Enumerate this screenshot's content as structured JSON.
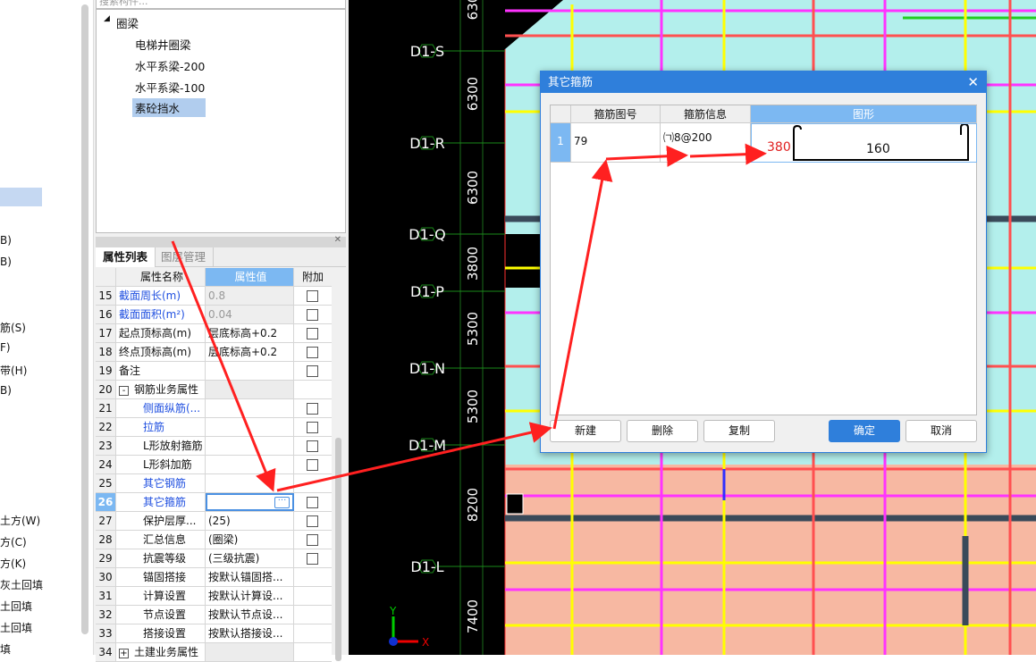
{
  "left_strip": {
    "items": [
      "B)",
      "B)",
      "筋(S)",
      "F)",
      "带(H)",
      "B)",
      "土方(W)",
      "方(C)",
      "方(K)",
      "灰土回填",
      "土回填",
      "土回填",
      "填"
    ]
  },
  "component_panel": {
    "search_placeholder": "搜索构件...",
    "tree": {
      "group": "圈梁",
      "items": [
        "电梯井圈梁",
        "水平系梁-200",
        "水平系梁-100",
        "素砼挡水"
      ],
      "selected": "素砼挡水"
    }
  },
  "property_panel": {
    "tabs": [
      "属性列表",
      "图层管理"
    ],
    "headers": [
      "属性名称",
      "属性值",
      "附加"
    ],
    "rows": [
      {
        "n": "15",
        "name": "截面周长(m)",
        "value": "0.8",
        "cb": true,
        "style": "blue-gray"
      },
      {
        "n": "16",
        "name": "截面面积(m²)",
        "value": "0.04",
        "cb": true,
        "style": "blue-gray"
      },
      {
        "n": "17",
        "name": "起点顶标高(m)",
        "value": "层底标高+0.2",
        "cb": true
      },
      {
        "n": "18",
        "name": "终点顶标高(m)",
        "value": "层底标高+0.2",
        "cb": true
      },
      {
        "n": "19",
        "name": "备注",
        "value": "",
        "cb": true
      },
      {
        "n": "20",
        "name": "钢筋业务属性",
        "value": "",
        "cb": false,
        "group": "-"
      },
      {
        "n": "21",
        "name": "侧面纵筋(...",
        "value": "",
        "cb": true,
        "child": true,
        "style": "blue"
      },
      {
        "n": "22",
        "name": "拉筋",
        "value": "",
        "cb": true,
        "child": true,
        "style": "blue"
      },
      {
        "n": "23",
        "name": "L形放射箍筋",
        "value": "",
        "cb": true,
        "child": true
      },
      {
        "n": "24",
        "name": "L形斜加筋",
        "value": "",
        "cb": true,
        "child": true
      },
      {
        "n": "25",
        "name": "其它钢筋",
        "value": "",
        "cb": false,
        "child": true,
        "style": "blue"
      },
      {
        "n": "26",
        "name": "其它箍筋",
        "value": "",
        "cb": true,
        "child": true,
        "style": "blue",
        "active": true
      },
      {
        "n": "27",
        "name": "保护层厚...",
        "value": "(25)",
        "cb": true,
        "child": true
      },
      {
        "n": "28",
        "name": "汇总信息",
        "value": "(圈梁)",
        "cb": true,
        "child": true
      },
      {
        "n": "29",
        "name": "抗震等级",
        "value": "(三级抗震)",
        "cb": true,
        "child": true
      },
      {
        "n": "30",
        "name": "锚固搭接",
        "value": "按默认锚固搭...",
        "cb": false,
        "child": true
      },
      {
        "n": "31",
        "name": "计算设置",
        "value": "按默认计算设...",
        "cb": false,
        "child": true
      },
      {
        "n": "32",
        "name": "节点设置",
        "value": "按默认节点设...",
        "cb": false,
        "child": true
      },
      {
        "n": "33",
        "name": "搭接设置",
        "value": "按默认搭接设...",
        "cb": false,
        "child": true
      },
      {
        "n": "34",
        "name": "土建业务属性",
        "value": "",
        "cb": false,
        "group": "+"
      }
    ]
  },
  "cad": {
    "axes": [
      "D1-S",
      "D1-R",
      "D1-Q",
      "D1-P",
      "D1-N",
      "D1-M",
      "D1-L"
    ],
    "dimensions": [
      "630",
      "6300",
      "6300",
      "3800",
      "5300",
      "5300",
      "8200",
      "7400"
    ],
    "ucs": {
      "x": "X",
      "y": "Y"
    }
  },
  "dialog": {
    "title": "其它箍筋",
    "headers": [
      "箍筋图号",
      "箍筋信息",
      "图形"
    ],
    "rows": [
      {
        "n": "1",
        "figure_no": "79",
        "info": "㈀8@200",
        "shape_left": "380",
        "shape_bottom": "160"
      }
    ],
    "buttons": {
      "new": "新建",
      "delete": "删除",
      "copy": "复制",
      "ok": "确定",
      "cancel": "取消"
    }
  },
  "colors": {
    "accent": "#2f7fdb",
    "header_blue": "#7cb8f2",
    "annotation": "#ff2020"
  }
}
